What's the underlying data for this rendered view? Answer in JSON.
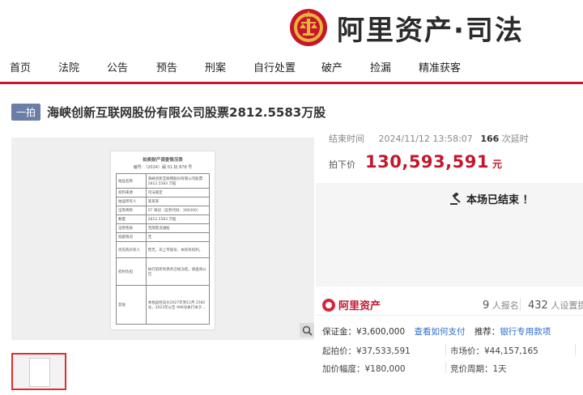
{
  "header": {
    "logo_text": "阿里资产·司法",
    "nav": [
      "首页",
      "法院",
      "公告",
      "预告",
      "刑案",
      "自行处置",
      "破产",
      "捡漏",
      "精准获客"
    ]
  },
  "item": {
    "tag": "一拍",
    "title": "海峡创新互联网股份有限公司股票2812.5583万股"
  },
  "auction": {
    "end_label": "结束时间",
    "end_time": "2024/11/12 13:58:07",
    "delay_count": "166",
    "delay_label": "次延时",
    "price_label": "拍下价",
    "price": "130,593,591",
    "price_unit": "元",
    "ended_text": "本场已结束 ！"
  },
  "stats": {
    "brand": "阿里资产",
    "signups": "9",
    "signups_label": "人报名",
    "reminders": "432",
    "reminders_label": "人设置提醒"
  },
  "details": {
    "deposit": "保证金：¥3,600,000",
    "deposit_link": "查看如何支付",
    "recommend_label": "推荐：",
    "recommend_value": "银行专用款项",
    "start_price": "起拍价：¥37,533,591",
    "market_price": "市场价：¥44,157,165",
    "increment": "加价幅度：¥180,000",
    "cycle": "竞价周期：1天"
  },
  "doc": {
    "title": "拍卖财产调查情况表",
    "number": "编号：（2024）闽 01 执 878 号",
    "rows": [
      [
        "拍品名称",
        "海峡创新互联网股份有限公司股票 2812.5583 万股"
      ],
      [
        "权利来源",
        "司法裁定"
      ],
      [
        "拍品所有人",
        "某某某"
      ],
      [
        "证券简称",
        "ST 海创（证券代码：300300）"
      ],
      [
        "数量",
        "2812.5583 万股"
      ],
      [
        "证券性质",
        "无限售流通股"
      ],
      [
        "瑕疵情况",
        "无"
      ],
      [
        "优先购买权人",
        "售无，非上市股份，本权有权利。"
      ],
      [
        "权利负担",
        "执行前所有债务已经冻结，请查阅公告"
      ],
      [
        "其他",
        "本拍品经竞价2027年到12月 2582号，2023年公告 996号执行关于..."
      ]
    ]
  }
}
